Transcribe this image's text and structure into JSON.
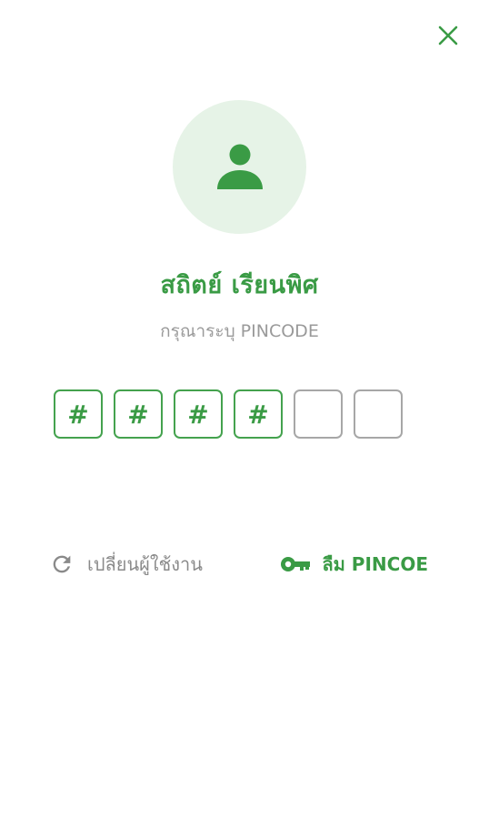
{
  "user": {
    "name": "สถิตย์ เรียนพิศ"
  },
  "prompt": {
    "subtitle": "กรุณาระบุ PINCODE"
  },
  "pin": {
    "length": 6,
    "entered": 4,
    "mask_char": "#",
    "digits": [
      "#",
      "#",
      "#",
      "#",
      "",
      ""
    ]
  },
  "actions": {
    "switch_user_label": "เปลี่ยนผู้ใช้งาน",
    "forgot_pin_label": "ลืม PINCOE"
  },
  "icons": {
    "close": "close-icon",
    "avatar": "user-icon",
    "switch_user": "refresh-icon",
    "forgot_pin": "key-icon"
  },
  "colors": {
    "accent": "#3a9b45",
    "avatar_bg": "#e6f3e7",
    "muted_text": "#9a9a9a",
    "empty_border": "#a7a7a7"
  }
}
